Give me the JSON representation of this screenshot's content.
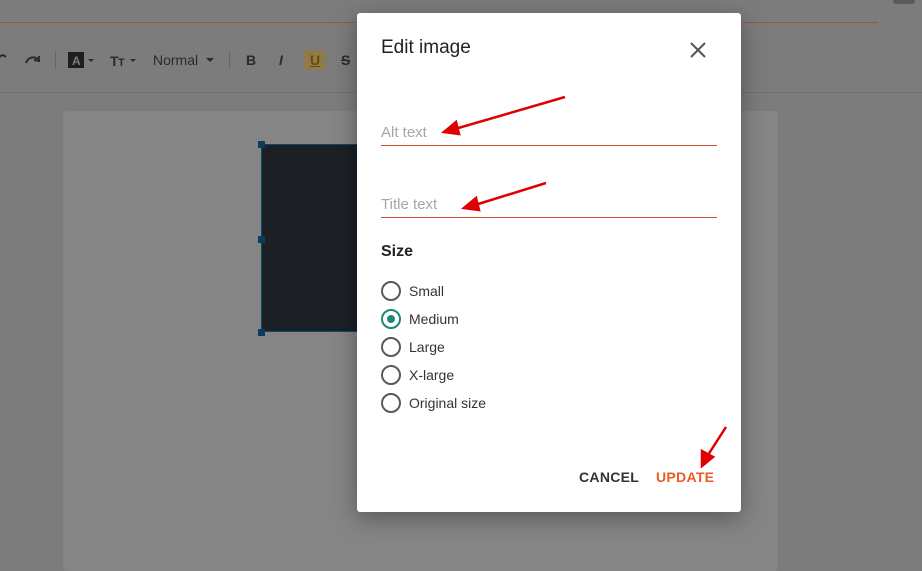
{
  "toolbar": {
    "paragraph_style": "Normal",
    "bold_glyph": "B",
    "italic_glyph": "I",
    "underline_glyph": "U",
    "strike_glyph": "S"
  },
  "dialog": {
    "title": "Edit image",
    "alt_text": {
      "value": "",
      "placeholder": "Alt text"
    },
    "title_text": {
      "value": "",
      "placeholder": "Title text"
    },
    "size_heading": "Size",
    "size_options": [
      {
        "label": "Small",
        "selected": false
      },
      {
        "label": "Medium",
        "selected": true
      },
      {
        "label": "Large",
        "selected": false
      },
      {
        "label": "X-large",
        "selected": false
      },
      {
        "label": "Original size",
        "selected": false
      }
    ],
    "cancel_label": "CANCEL",
    "update_label": "UPDATE"
  },
  "colors": {
    "accent_update": "#ef5a24",
    "field_underline": "#d2542c",
    "radio_selected": "#1b8a74",
    "annotation_arrow": "#e00000"
  },
  "icons": {
    "close": "close-icon",
    "undo": "undo-icon",
    "redo": "redo-icon",
    "text_color": "text-color-icon",
    "font_size": "font-size-icon"
  }
}
